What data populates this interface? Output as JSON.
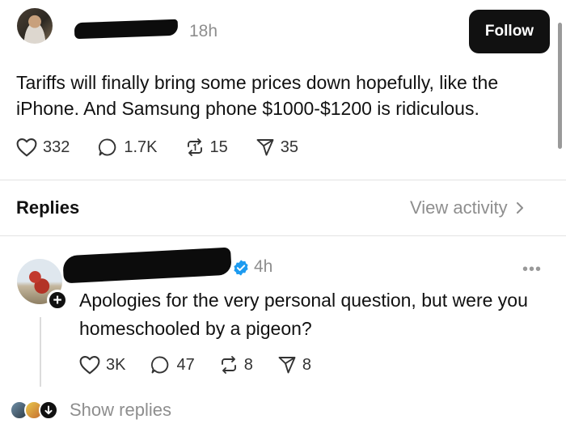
{
  "post": {
    "time": "18h",
    "follow_label": "Follow",
    "text": "Tariffs will finally bring some prices down hopefully, like the iPhone. And Samsung phone $1000-$1200 is ridiculous.",
    "likes": "332",
    "comments": "1.7K",
    "reposts": "15",
    "shares": "35"
  },
  "replies_header": {
    "title": "Replies",
    "view_activity": "View activity"
  },
  "reply": {
    "time": "4h",
    "badge": "+",
    "text": "Apologies for the very personal question, but were you homeschooled by a pigeon?",
    "likes": "3K",
    "comments": "47",
    "reposts": "8",
    "shares": "8",
    "show_replies": "Show replies"
  },
  "icons": [
    "heart-icon",
    "comment-icon",
    "repost-icon",
    "share-icon",
    "verified-icon",
    "chevron-right-icon",
    "more-icon",
    "arrow-down-icon"
  ],
  "colors": {
    "follow_bg": "#111111",
    "muted": "#8e8e8e",
    "verified": "#1d9bf0"
  }
}
